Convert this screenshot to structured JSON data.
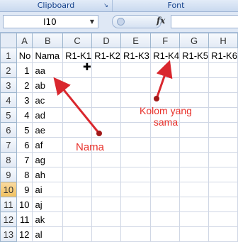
{
  "ribbon": {
    "clipboard_label": "Clipboard",
    "font_label": "Font",
    "dialog_launcher_icon": "dialog-launcher-icon"
  },
  "formula_bar": {
    "name_box_value": "I10",
    "fx_label": "fx",
    "formula_value": ""
  },
  "columns": [
    "A",
    "B",
    "C",
    "D",
    "E",
    "F",
    "G",
    "H"
  ],
  "selected_column": "I",
  "selected_row": 10,
  "rows": [
    {
      "row": "1",
      "cells": [
        "No",
        "Nama",
        "R1-K1",
        "R1-K2",
        "R1-K3",
        "R1-K4",
        "R1-K5",
        "R1-K6"
      ]
    },
    {
      "row": "2",
      "cells": [
        "1",
        "aa",
        "",
        "",
        "",
        "",
        "",
        ""
      ]
    },
    {
      "row": "3",
      "cells": [
        "2",
        "ab",
        "",
        "",
        "",
        "",
        "",
        ""
      ]
    },
    {
      "row": "4",
      "cells": [
        "3",
        "ac",
        "",
        "",
        "",
        "",
        "",
        ""
      ]
    },
    {
      "row": "5",
      "cells": [
        "4",
        "ad",
        "",
        "",
        "",
        "",
        "",
        ""
      ]
    },
    {
      "row": "6",
      "cells": [
        "5",
        "ae",
        "",
        "",
        "",
        "",
        "",
        ""
      ]
    },
    {
      "row": "7",
      "cells": [
        "6",
        "af",
        "",
        "",
        "",
        "",
        "",
        ""
      ]
    },
    {
      "row": "8",
      "cells": [
        "7",
        "ag",
        "",
        "",
        "",
        "",
        "",
        ""
      ]
    },
    {
      "row": "9",
      "cells": [
        "8",
        "ah",
        "",
        "",
        "",
        "",
        "",
        ""
      ]
    },
    {
      "row": "10",
      "cells": [
        "9",
        "ai",
        "",
        "",
        "",
        "",
        "",
        ""
      ]
    },
    {
      "row": "11",
      "cells": [
        "10",
        "aj",
        "",
        "",
        "",
        "",
        "",
        ""
      ]
    },
    {
      "row": "12",
      "cells": [
        "11",
        "ak",
        "",
        "",
        "",
        "",
        "",
        ""
      ]
    },
    {
      "row": "13",
      "cells": [
        "12",
        "al",
        "",
        "",
        "",
        "",
        "",
        ""
      ]
    }
  ],
  "annotations": {
    "nama_label": "Nama",
    "kolom_label_line1": "Kolom yang",
    "kolom_label_line2": "sama",
    "color": "#d9272e"
  },
  "colors": {
    "header_selected": "#f5c86a",
    "grid_line": "#d0d7e5",
    "ribbon_text": "#15428b"
  }
}
